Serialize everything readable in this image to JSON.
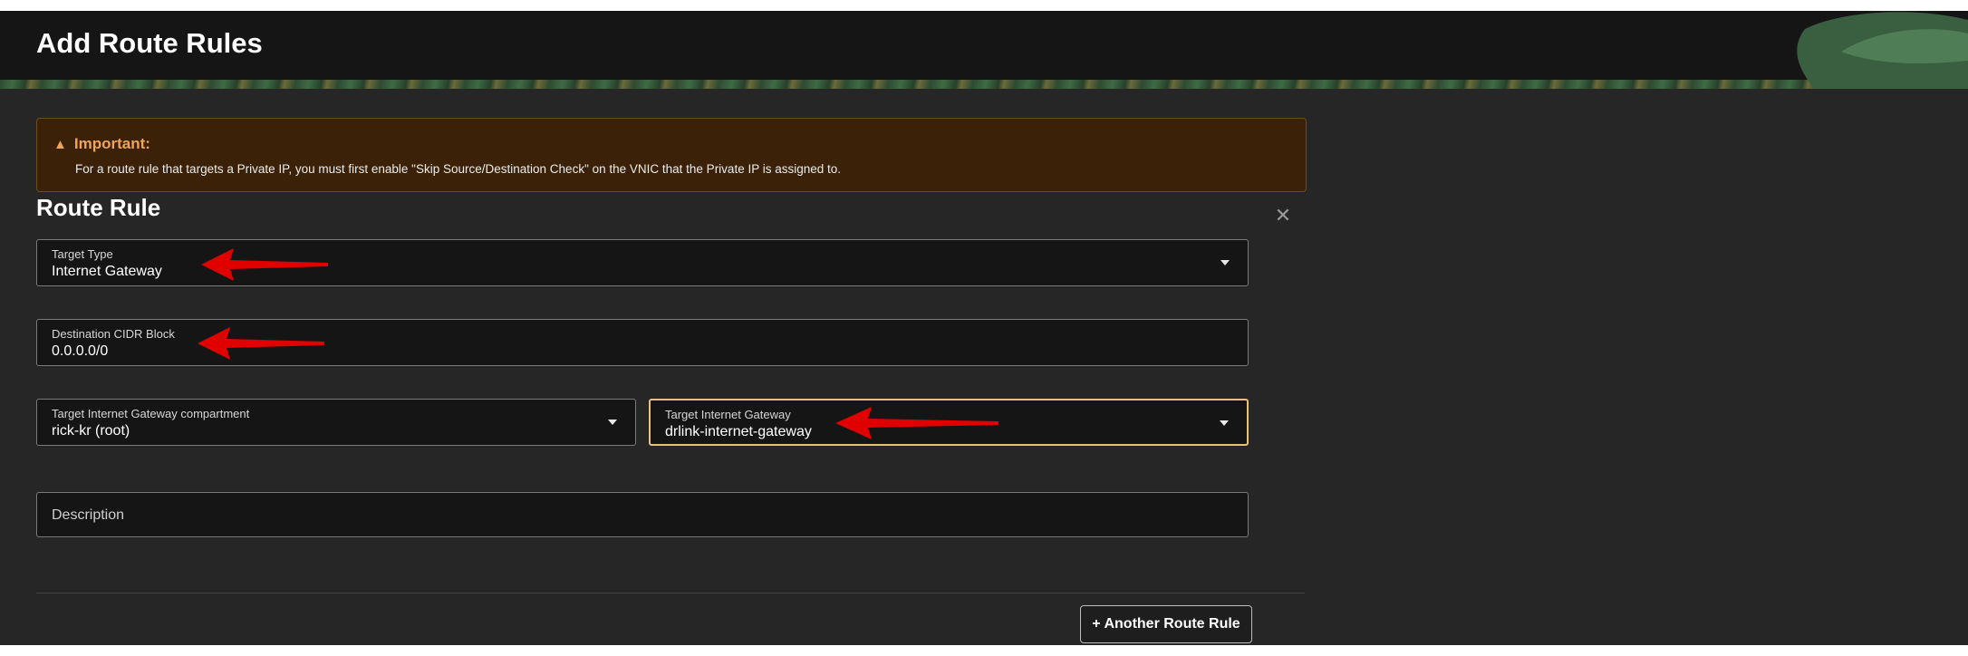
{
  "header": {
    "title": "Add Route Rules"
  },
  "alert": {
    "icon": "warning-icon",
    "title": "Important:",
    "text": "For a route rule that targets a Private IP, you must first enable \"Skip Source/Destination Check\" on the VNIC that the Private IP is assigned to."
  },
  "route_rule": {
    "title": "Route Rule",
    "target_type": {
      "label": "Target Type",
      "value": "Internet Gateway"
    },
    "destination_cidr": {
      "label": "Destination CIDR Block",
      "value": "0.0.0.0/0"
    },
    "compartment": {
      "label": "Target Internet Gateway compartment",
      "value": "rick-kr (root)"
    },
    "gateway": {
      "label": "Target Internet Gateway",
      "value": "drlink-internet-gateway"
    },
    "description": {
      "placeholder": "Description"
    }
  },
  "actions": {
    "add_rule": "+ Another Route Rule"
  },
  "colors": {
    "accent_focus": "#e6c27a",
    "alert_bg": "#3b2107",
    "alert_title": "#f2a35a",
    "annotation_arrow": "#e00000"
  }
}
